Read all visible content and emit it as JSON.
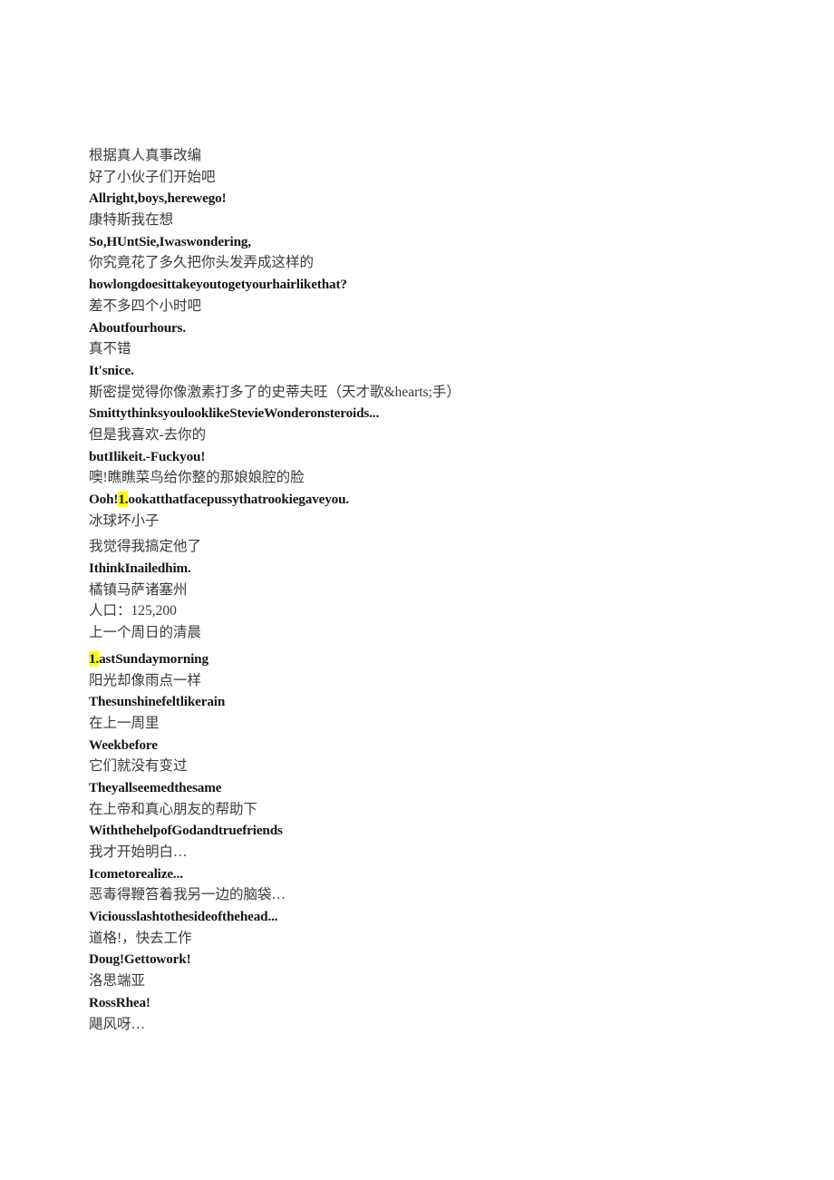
{
  "document": {
    "page_background": "#ffffff",
    "highlight_color": "#ffff00",
    "text_color_zh": "#3a3a3a",
    "text_color_en": "#161616",
    "lines": [
      {
        "id": "l01",
        "lang": "zh",
        "text": "根据真人真事改编"
      },
      {
        "id": "l02",
        "lang": "zh",
        "text": "好了小伙子们开始吧"
      },
      {
        "id": "l03",
        "lang": "en",
        "text": "Allright,boys,herewego!"
      },
      {
        "id": "l04",
        "lang": "zh",
        "text": "康特斯我在想"
      },
      {
        "id": "l05",
        "lang": "en",
        "text": "So,HUntSie,Iwaswondering,"
      },
      {
        "id": "l06",
        "lang": "zh",
        "text": "你究竟花了多久把你头发弄成这样的"
      },
      {
        "id": "l07",
        "lang": "en",
        "text": "howlongdoesittakeyoutogetyourhairlikethat?"
      },
      {
        "id": "l08",
        "lang": "zh",
        "text": "差不多四个小时吧"
      },
      {
        "id": "l09",
        "lang": "en",
        "text": "Aboutfourhours."
      },
      {
        "id": "l10",
        "lang": "zh",
        "text": "真不错"
      },
      {
        "id": "l11",
        "lang": "en",
        "text": "It'snice."
      },
      {
        "id": "l12",
        "lang": "zh",
        "text": "斯密提觉得你像激素打多了的史蒂夫旺（天才歌&hearts;手）"
      },
      {
        "id": "l13",
        "lang": "en",
        "text": "SmittythinksyoulooklikeStevieWonderonsteroids..."
      },
      {
        "id": "l14",
        "lang": "zh",
        "text": "但是我喜欢-去你的"
      },
      {
        "id": "l15",
        "lang": "en",
        "text": "butIlikeit.-Fuckyou!"
      },
      {
        "id": "l16",
        "lang": "zh",
        "text": "噢!瞧瞧菜鸟给你整的那娘娘腔的脸"
      },
      {
        "id": "l17",
        "lang": "en",
        "highlight_prefix": "1.",
        "text_after": "ookatthatfacepussythatrookiegaveyou.",
        "text_before": "Ooh!",
        "text": "Ooh!1.ookatthatfacepussythatrookiegaveyou."
      },
      {
        "id": "l18",
        "lang": "zh",
        "text": "冰球坏小子"
      },
      {
        "id": "l19",
        "lang": "zh",
        "text": "我觉得我搞定他了",
        "gap_before": true
      },
      {
        "id": "l20",
        "lang": "en",
        "text": "IthinkInailedhim."
      },
      {
        "id": "l21",
        "lang": "zh",
        "text": "橘镇马萨诸塞州"
      },
      {
        "id": "l22",
        "lang": "zh",
        "text": "人口：125,200"
      },
      {
        "id": "l23",
        "lang": "zh",
        "text": "上一个周日的清晨"
      },
      {
        "id": "l24",
        "lang": "en",
        "highlight_prefix": "1.",
        "text_before": "",
        "text_after": "astSundaymorning",
        "text": "1.astSundaymorning",
        "gap_before": true
      },
      {
        "id": "l25",
        "lang": "zh",
        "text": "阳光却像雨点一样"
      },
      {
        "id": "l26",
        "lang": "en",
        "text": "Thesunshinefeltlikerain"
      },
      {
        "id": "l27",
        "lang": "zh",
        "text": "在上一周里"
      },
      {
        "id": "l28",
        "lang": "en",
        "text": "Weekbefore"
      },
      {
        "id": "l29",
        "lang": "zh",
        "text": "它们就没有变过"
      },
      {
        "id": "l30",
        "lang": "en",
        "text": "Theyallseemedthesame"
      },
      {
        "id": "l31",
        "lang": "zh",
        "text": "在上帝和真心朋友的帮助下"
      },
      {
        "id": "l32",
        "lang": "en",
        "text": "WiththehelpofGodandtruefriends"
      },
      {
        "id": "l33",
        "lang": "zh",
        "text": "我才开始明白…"
      },
      {
        "id": "l34",
        "lang": "en",
        "text": "Icometorealize..."
      },
      {
        "id": "l35",
        "lang": "zh",
        "text": "恶毒得鞭笞着我另一边的脑袋…"
      },
      {
        "id": "l36",
        "lang": "en",
        "text": "Viciousslashtothesideofthehead..."
      },
      {
        "id": "l37",
        "lang": "zh",
        "text": "道格!，快去工作"
      },
      {
        "id": "l38",
        "lang": "en",
        "text": "Doug!Gettowork!"
      },
      {
        "id": "l39",
        "lang": "zh",
        "text": "洛思端亚"
      },
      {
        "id": "l40",
        "lang": "en",
        "text": "RossRhea!"
      },
      {
        "id": "l41",
        "lang": "zh",
        "text": "飓风呀…"
      }
    ]
  }
}
